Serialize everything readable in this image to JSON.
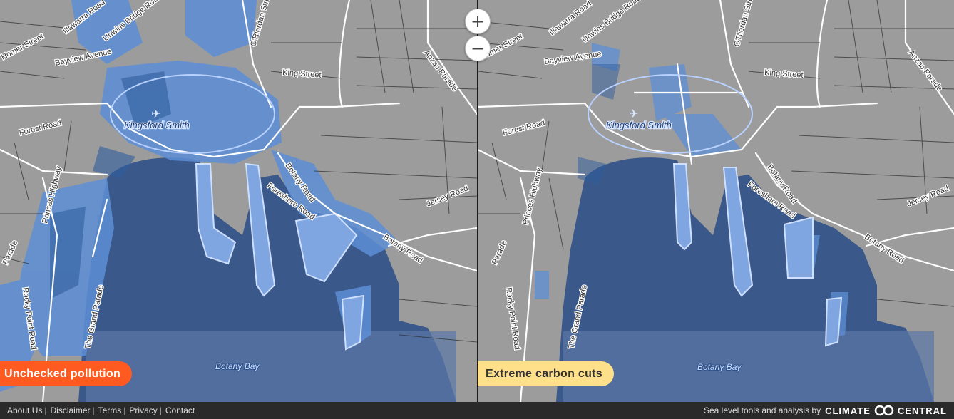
{
  "map": {
    "left_scenario": "Unchecked pollution",
    "right_scenario": "Extreme carbon cuts",
    "place_label": "Kingsford Smith",
    "water_label": "Botany Bay",
    "road_labels": {
      "illawarra": "Illawarra Road",
      "unwins": "Unwins Bridge Road",
      "oriordan": "O'Riordan Street",
      "anzac": "Anzac Parade",
      "homer": "Homer Street",
      "bayview": "Bayview Avenue",
      "king": "King Street",
      "forest": "Forest Road",
      "princes": "Princes Highway",
      "botany1": "Botany Road",
      "foreshore": "Foreshore Road",
      "jersey": "Jersey Road",
      "botany2": "Botany Road",
      "parade": "Parade",
      "rocky": "Rocky Point Road",
      "grand": "The Grand Parade"
    },
    "colors": {
      "land": "#9c9c9c",
      "bay": "#3a5889",
      "flood": "#5d8fd6",
      "left_tag": "#ff5a1f",
      "right_tag": "#ffe08a"
    }
  },
  "zoom": {
    "in_symbol": "+",
    "out_symbol": "−"
  },
  "footer": {
    "links": [
      "About Us",
      "Disclaimer",
      "Terms",
      "Privacy",
      "Contact"
    ],
    "separator": "|",
    "credit_text": "Sea level tools and analysis by",
    "brand_left": "CLIMATE",
    "brand_right": "CENTRAL"
  }
}
